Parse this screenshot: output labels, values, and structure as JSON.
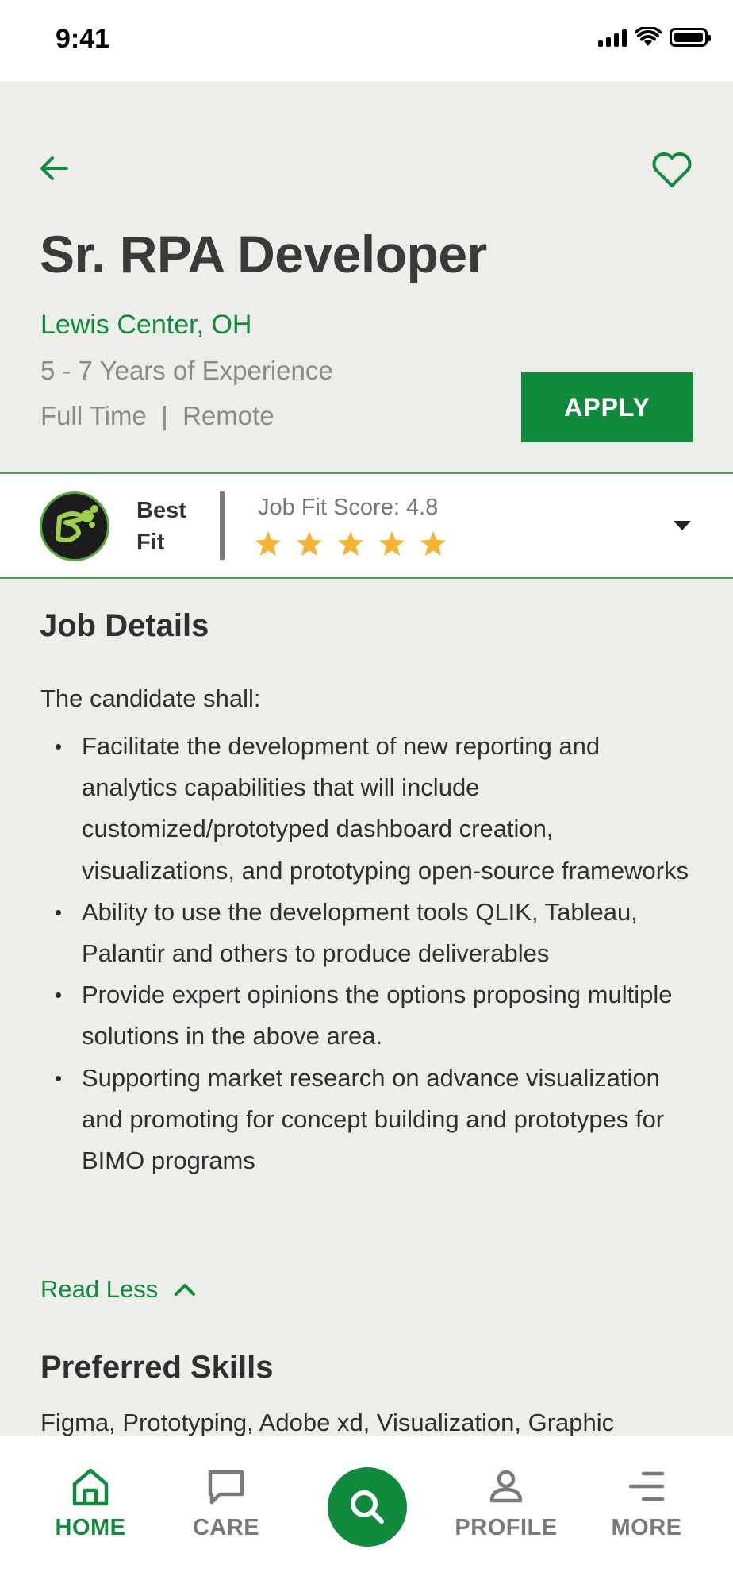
{
  "status_bar": {
    "time": "9:41"
  },
  "job": {
    "title": "Sr. RPA Developer",
    "location": "Lewis Center, OH",
    "experience": "5 - 7 Years of Experience",
    "type": "Full Time  |  Remote",
    "apply_label": "APPLY"
  },
  "fit": {
    "label": "Best Fit",
    "score_text": "Job Fit Score: 4.8",
    "rating": 4.8,
    "stars_max": 5,
    "star_color": "#f2b431"
  },
  "details": {
    "title": "Job Details",
    "intro": "The candidate shall:",
    "bullets": [
      "Facilitate the development of new reporting and analytics capabilities that will include customized/prototyped dashboard creation, visualizations, and prototyping open-source frameworks",
      "Ability to use the development tools QLIK, Tableau, Palantir and others to produce deliverables",
      "Provide expert opinions the options proposing multiple solutions in the above area.",
      "Supporting market research on advance visualization and promoting for concept building and prototypes for BIMO programs"
    ],
    "read_less_label": "Read Less"
  },
  "skills": {
    "title": "Preferred Skills",
    "text": "Figma, Prototyping, Adobe xd, Visualization, Graphic"
  },
  "nav": {
    "home": "HOME",
    "care": "CARE",
    "profile": "PROFILE",
    "more": "MORE"
  },
  "colors": {
    "brand_green": "#108a3c",
    "background": "#ededea",
    "star": "#f2b431"
  }
}
